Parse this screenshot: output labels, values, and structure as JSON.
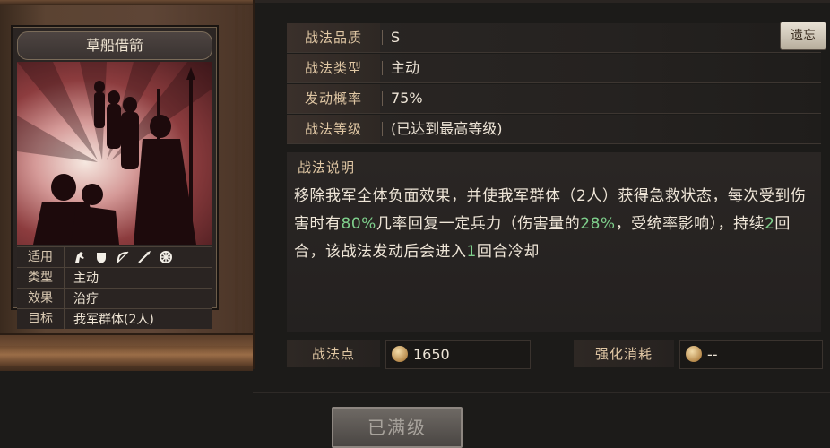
{
  "card": {
    "title": "草船借箭",
    "attributes": [
      {
        "key": "适用",
        "value": ""
      },
      {
        "key": "类型",
        "value": "主动"
      },
      {
        "key": "效果",
        "value": "治疗"
      },
      {
        "key": "目标",
        "value": "我军群体(2人)"
      }
    ],
    "applicable_icons": [
      "cavalry-icon",
      "shield-icon",
      "bow-icon",
      "spear-icon",
      "wheel-icon"
    ]
  },
  "details": {
    "quality_label": "战法品质",
    "quality_value": "S",
    "type_label": "战法类型",
    "type_value": "主动",
    "chance_label": "发动概率",
    "chance_value": "75%",
    "level_label": "战法等级",
    "level_value": "(已达到最高等级)"
  },
  "description": {
    "label": "战法说明",
    "parts": {
      "p1": "移除我军全体负面效果，并使我军群体（2人）获得急救状态，每次受到伤害时有",
      "h1": "80%",
      "p2": "几率回复一定兵力（伤害量的",
      "h2": "28%",
      "p3": "，受统率影响），持续",
      "h3": "2",
      "p4": "回合，该战法发动后会进入",
      "h4": "1",
      "p5": "回合冷却"
    }
  },
  "buttons": {
    "reset": "遗忘",
    "max_level": "已满级"
  },
  "costs": {
    "points_label": "战法点",
    "points_value": "1650",
    "upgrade_label": "强化消耗",
    "upgrade_value": "--"
  },
  "colors": {
    "highlight": "#7fd08c",
    "label": "#e0c7a4"
  }
}
